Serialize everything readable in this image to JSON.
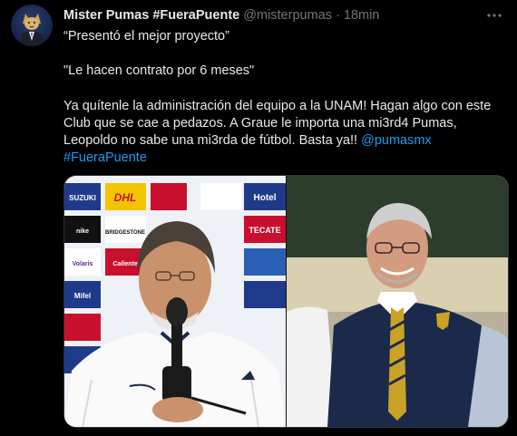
{
  "tweet": {
    "author_name": "Mister Pumas #FueraPuente",
    "handle": "@misterpumas",
    "separator": "·",
    "time": "18min",
    "lines": [
      "“Presentó el mejor proyecto”",
      "",
      "\"Le hacen contrato por 6 meses\"",
      "",
      "Ya quítenle la administración del equipo a la UNAM! Hagan algo con este",
      "Club que se cae a pedazos. A Graue le importa una mi3rd4 Pumas,"
    ],
    "line_last_prefix": "Leopoldo no sabe una mi3rda de fútbol. Basta ya!! ",
    "mention": "@pumasmx",
    "hashtag": "#FueraPuente"
  },
  "media": {
    "sponsor_logos": [
      "SUZUKI",
      "DHL",
      "BRIDGESTONE",
      "TECATE",
      "Hotel",
      "Volaris",
      "Caliente",
      "Mifel",
      "nike"
    ]
  },
  "icons": {
    "more": "more-horizontal-icon",
    "avatar": "puma-avatar"
  },
  "colors": {
    "background": "#000000",
    "text": "#e7e9ea",
    "muted": "#71767b",
    "link": "#1d9bf0"
  }
}
